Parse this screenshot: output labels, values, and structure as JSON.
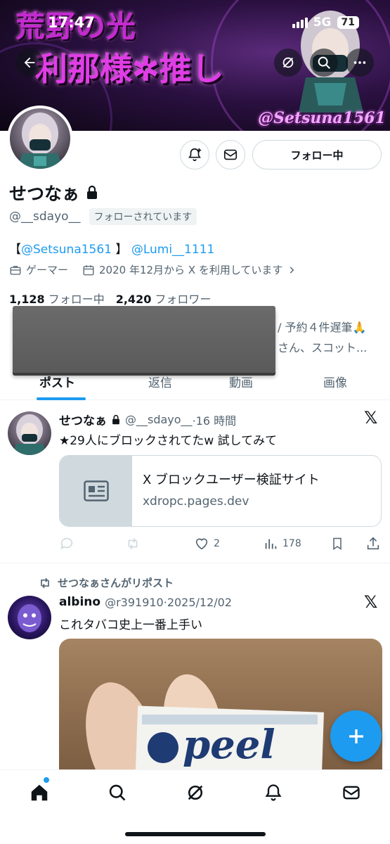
{
  "status_bar": {
    "time": "17:47",
    "network": "5G",
    "battery": "71"
  },
  "banner": {
    "title_line1": "荒野の光",
    "title_line2": "利那様✲推し",
    "handle": "@Setsuna1561"
  },
  "profile": {
    "name": "せつなぁ",
    "handle": "@__sdayo__",
    "follows_you": "フォローされています",
    "follow_button": "フォロー中",
    "bio": {
      "open_bracket": "【",
      "link1": "@Setsuna1561",
      "close_bracket": "】",
      "link2": "@Lumi__1111"
    },
    "category": "ゲーマー",
    "joined": "2020 年12月から X を利用しています",
    "following_count": "1,128",
    "following_label": "フォロー中",
    "followers_count": "2,420",
    "followers_label": "フォロワー",
    "peek_line1": "/ 予約４件遅筆🙏",
    "peek_line2": "さん、スコット..."
  },
  "tabs": [
    "ポスト",
    "返信",
    "動画",
    "画像"
  ],
  "post1": {
    "author": "せつなぁ",
    "handle": "@__sdayo__",
    "time": "·16 時間",
    "text": "★29人にブロックされてたw 試してみて",
    "card_title": "X ブロックユーザー検証サイト",
    "card_domain": "xdropc.pages.dev",
    "likes": "2",
    "views": "178"
  },
  "post2": {
    "repost_note": "せつなぁさんがリポスト",
    "author": "albino",
    "handle": "@r391910",
    "time": "·2025/12/02",
    "text": "これタバコ史上一番上手い",
    "photo_text": "peel"
  },
  "colors": {
    "accent": "#1d9bf0",
    "text": "#0f1419",
    "muted": "#536471"
  }
}
